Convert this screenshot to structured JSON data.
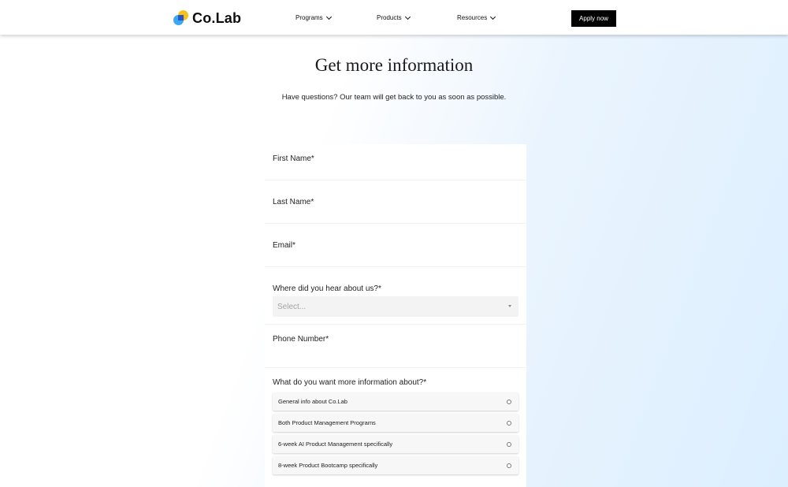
{
  "header": {
    "logo_text": "Co.Lab",
    "nav": [
      {
        "label": "Programs",
        "icon": "chevron-down-icon"
      },
      {
        "label": "Products",
        "icon": "chevron-down-icon"
      },
      {
        "label": "Resources",
        "icon": "chevron-down-icon"
      }
    ],
    "cta_label": "Apply now"
  },
  "hero": {
    "title": "Get more information",
    "subtitle": "Have questions? Our team will get back to you as soon as possible."
  },
  "form": {
    "first_name_label": "First Name*",
    "last_name_label": "Last Name*",
    "email_label": "Email*",
    "source_label": "Where did you hear about us?*",
    "source_placeholder": "Select...",
    "phone_label": "Phone Number*",
    "interest_label": "What do you want more information about?*",
    "interest_options": [
      "General info about Co.Lab",
      "Both Product Management Programs",
      "6-week AI Product Management specifically",
      "8-week Product Bootcamp specifically"
    ]
  },
  "colors": {
    "cta_bg": "#000000",
    "logo_yellow": "#f6c21b",
    "logo_blue": "#3ca8f5",
    "logo_navy": "#2b54c9",
    "bg_gradient_end": "#dcefff"
  }
}
